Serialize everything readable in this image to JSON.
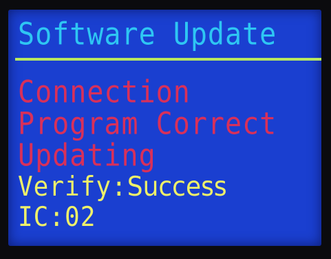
{
  "screen": {
    "title": "Software Update",
    "steps": [
      "Connection",
      "Program Correct",
      "Updating"
    ],
    "verify": {
      "label": "Verify:",
      "value": "Success"
    },
    "ic": "IC:02"
  },
  "colors": {
    "background": "#1a3fd0",
    "title": "#2ec6f3",
    "divider": "#b8e860",
    "step": "#d8305a",
    "status": "#eef06a"
  }
}
